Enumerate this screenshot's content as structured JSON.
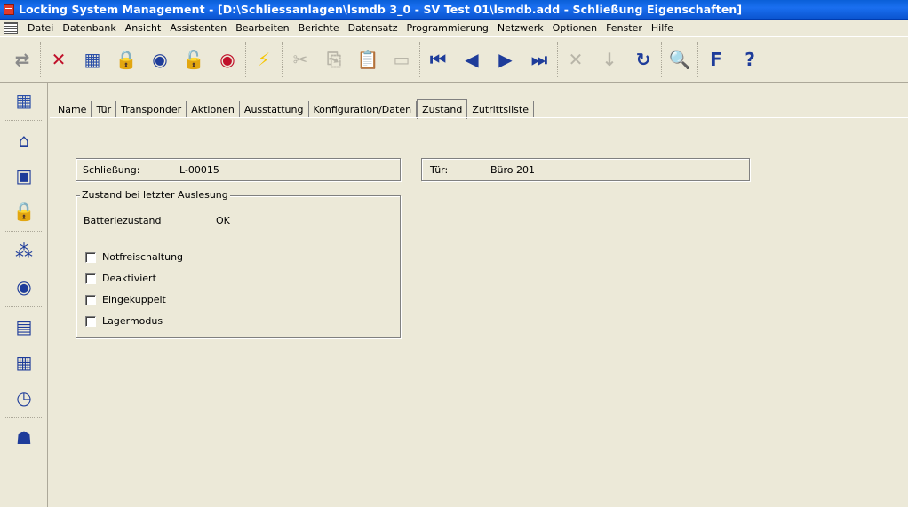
{
  "window": {
    "title": "Locking System Management - [D:\\Schliessanlagen\\lsmdb 3_0 - SV Test 01\\lsmdb.add - Schließung Eigenschaften]"
  },
  "menu": {
    "items": [
      {
        "label": "Datei"
      },
      {
        "label": "Datenbank"
      },
      {
        "label": "Ansicht"
      },
      {
        "label": "Assistenten"
      },
      {
        "label": "Bearbeiten"
      },
      {
        "label": "Berichte"
      },
      {
        "label": "Datensatz"
      },
      {
        "label": "Programmierung"
      },
      {
        "label": "Netzwerk"
      },
      {
        "label": "Optionen"
      },
      {
        "label": "Fenster"
      },
      {
        "label": "Hilfe"
      }
    ]
  },
  "toolbar": {
    "buttons": [
      {
        "icon": "redo-arrow-icon",
        "glyph": "⇄",
        "color": "#8a8a8a",
        "disabled": true
      },
      {
        "icon": "cross-lock-icon",
        "glyph": "✕",
        "color": "#c0102a"
      },
      {
        "icon": "new-area-icon",
        "glyph": "▦",
        "color": "#2b4fa8"
      },
      {
        "icon": "new-lock-icon",
        "glyph": "🔒",
        "color": "#1e3c9a"
      },
      {
        "icon": "new-transponder-icon",
        "glyph": "◉",
        "color": "#1e3c9a"
      },
      {
        "icon": "lock-question-icon",
        "glyph": "🔓",
        "color": "#c0102a"
      },
      {
        "icon": "transponder-question-icon",
        "glyph": "◉",
        "color": "#c0102a"
      },
      {
        "icon": "lightning-icon",
        "glyph": "⚡",
        "color": "#f5c400"
      },
      {
        "icon": "cut-icon",
        "glyph": "✂",
        "color": "#b8b5a8",
        "disabled": true
      },
      {
        "icon": "copy-icon",
        "glyph": "⎘",
        "color": "#b8b5a8",
        "disabled": true
      },
      {
        "icon": "paste-icon",
        "glyph": "📋",
        "color": "#b8b5a8",
        "disabled": true
      },
      {
        "icon": "save-icon",
        "glyph": "▭",
        "color": "#b8b5a8",
        "disabled": true
      },
      {
        "icon": "first-record-icon",
        "glyph": "⏮",
        "color": "#1e3c9a"
      },
      {
        "icon": "prev-record-icon",
        "glyph": "◀",
        "color": "#1e3c9a"
      },
      {
        "icon": "next-record-icon",
        "glyph": "▶",
        "color": "#1e3c9a"
      },
      {
        "icon": "last-record-icon",
        "glyph": "⏭",
        "color": "#1e3c9a"
      },
      {
        "icon": "delete-record-icon",
        "glyph": "✕",
        "color": "#b8b5a8",
        "disabled": true
      },
      {
        "icon": "apply-record-icon",
        "glyph": "↓",
        "color": "#b8b5a8",
        "disabled": true
      },
      {
        "icon": "refresh-icon",
        "glyph": "↻",
        "color": "#1e3c9a"
      },
      {
        "icon": "search-icon",
        "glyph": "🔍",
        "color": "#1e3c9a"
      },
      {
        "icon": "function-settings-icon",
        "glyph": "F",
        "color": "#1e3c9a"
      },
      {
        "icon": "help-icon",
        "glyph": "?",
        "color": "#1e3c9a"
      }
    ]
  },
  "sidebar": {
    "buttons": [
      {
        "icon": "grid-view-icon",
        "glyph": "▦",
        "color": "#2b4fa8"
      },
      {
        "icon": "building-icon",
        "glyph": "⌂",
        "color": "#1e3c9a"
      },
      {
        "icon": "door-icon",
        "glyph": "▣",
        "color": "#1e3c9a"
      },
      {
        "icon": "lock-icon",
        "glyph": "🔒",
        "color": "#1e3c9a"
      },
      {
        "icon": "transponder-group-icon",
        "glyph": "⁂",
        "color": "#1e3c9a"
      },
      {
        "icon": "transponder-icon",
        "glyph": "◉",
        "color": "#1e3c9a"
      },
      {
        "icon": "time-table-icon",
        "glyph": "▤",
        "color": "#1e3c9a"
      },
      {
        "icon": "calendar-icon",
        "glyph": "▦",
        "color": "#1e3c9a"
      },
      {
        "icon": "time-zone-icon",
        "glyph": "◷",
        "color": "#1e3c9a"
      },
      {
        "icon": "person-icon",
        "glyph": "☗",
        "color": "#1e3c9a"
      }
    ]
  },
  "tabs": [
    {
      "label": "Name"
    },
    {
      "label": "Tür"
    },
    {
      "label": "Transponder"
    },
    {
      "label": "Aktionen"
    },
    {
      "label": "Ausstattung"
    },
    {
      "label": "Konfiguration/Daten"
    },
    {
      "label": "Zustand",
      "active": true
    },
    {
      "label": "Zutrittsliste"
    }
  ],
  "lock": {
    "label": "Schließung:",
    "value": "L-00015"
  },
  "door": {
    "label": "Tür:",
    "value": "Büro 201"
  },
  "status_group": {
    "legend": "Zustand bei letzter Auslesung",
    "battery_label": "Batteriezustand",
    "battery_value": "OK",
    "checkboxes": [
      {
        "label": "Notfreischaltung",
        "checked": false
      },
      {
        "label": "Deaktiviert",
        "checked": false
      },
      {
        "label": "Eingekuppelt",
        "checked": false
      },
      {
        "label": "Lagermodus",
        "checked": false
      }
    ]
  }
}
